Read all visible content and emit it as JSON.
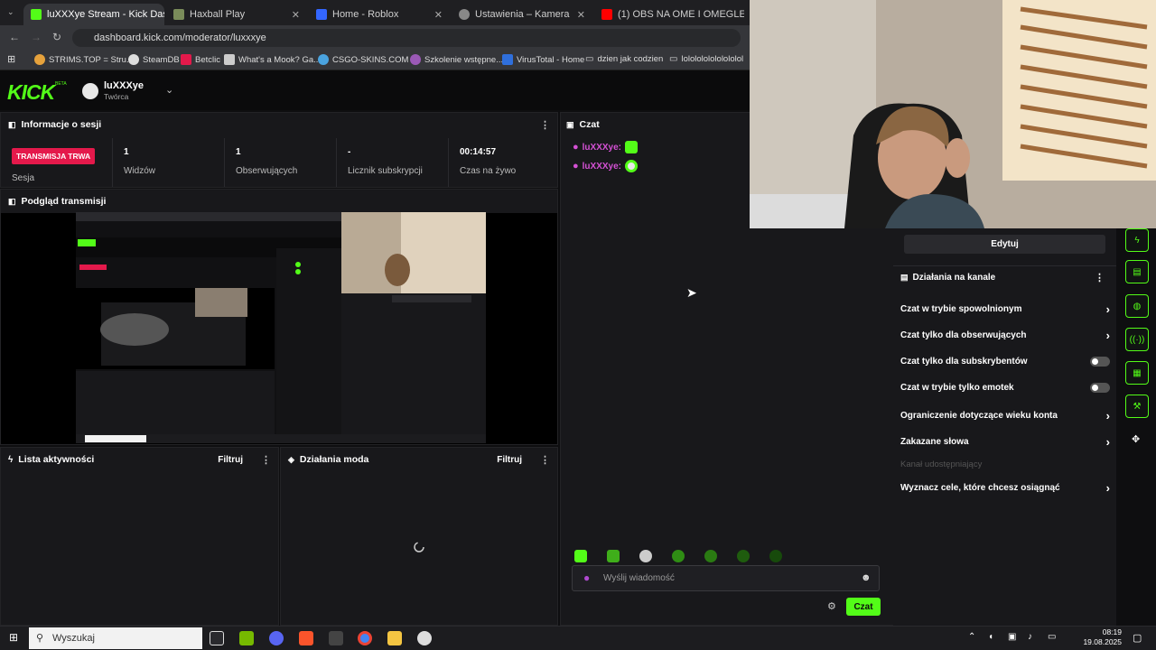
{
  "browser": {
    "tabs": [
      {
        "title": "luXXXye Stream - Kick Dashbo",
        "color": "#53fc18"
      },
      {
        "title": "Haxball Play",
        "color": "#7a8c5a"
      },
      {
        "title": "Home - Roblox",
        "color": "#3366ff"
      },
      {
        "title": "Ustawienia – Kamera",
        "color": "#888888"
      },
      {
        "title": "(1) OBS NA OME I OMEGLE | W",
        "color": "#ff0000"
      }
    ],
    "url": "dashboard.kick.com/moderator/luxxxye",
    "bookmarks": [
      "STRIMS.TOP = Stru...",
      "SteamDB",
      "Betclic",
      "What's a Mook? Ga...",
      "CSGO-SKINS.COM -...",
      "Szkolenie wstępne...",
      "VirusTotal - Home",
      "dzien jak codzien",
      "lololololololololol"
    ]
  },
  "header": {
    "logo": "KICK",
    "beta": "BETA",
    "username": "luXXXye",
    "role": "Twórca"
  },
  "session": {
    "title": "Informacje o sesji",
    "live_badge": "TRANSMISJA TRWA",
    "session_label": "Sesja",
    "stats": [
      {
        "value": "1",
        "label": "Widzów"
      },
      {
        "value": "1",
        "label": "Obserwujących"
      },
      {
        "value": "-",
        "label": "Licznik subskrypcji"
      },
      {
        "value": "00:14:57",
        "label": "Czas na żywo"
      }
    ]
  },
  "preview": {
    "title": "Podgląd transmisji"
  },
  "activity": {
    "title": "Lista aktywności",
    "filter": "Filtruj"
  },
  "modactions": {
    "title": "Działania moda",
    "filter": "Filtruj"
  },
  "chat": {
    "title": "Czat",
    "messages": [
      {
        "user": "luXXXye:"
      },
      {
        "user": "luXXXye:"
      }
    ],
    "input_placeholder": "Wyślij wiadomość",
    "send_label": "Czat"
  },
  "channel": {
    "edit_label": "Edytuj",
    "title": "Działania na kanale",
    "actions": [
      {
        "label": "Czat w trybie spowolnionym",
        "kind": "chevron"
      },
      {
        "label": "Czat tylko dla obserwujących",
        "kind": "chevron"
      },
      {
        "label": "Czat tylko dla subskrybentów",
        "kind": "toggle"
      },
      {
        "label": "Czat w trybie tylko emotek",
        "kind": "toggle"
      },
      {
        "label": "Ograniczenie dotyczące wieku konta",
        "kind": "chevron"
      },
      {
        "label": "Zakazane słowa",
        "kind": "chevron"
      }
    ],
    "shared_label": "Kanał udostępniający",
    "goals_label": "Wyznacz cele, które chcesz osiągnąć"
  },
  "taskbar": {
    "search_placeholder": "Wyszukaj",
    "time": "08:19",
    "date": "19.08.2025"
  },
  "colors": {
    "accent": "#53fc18",
    "live": "#e4194b",
    "username": "#d451d4"
  }
}
